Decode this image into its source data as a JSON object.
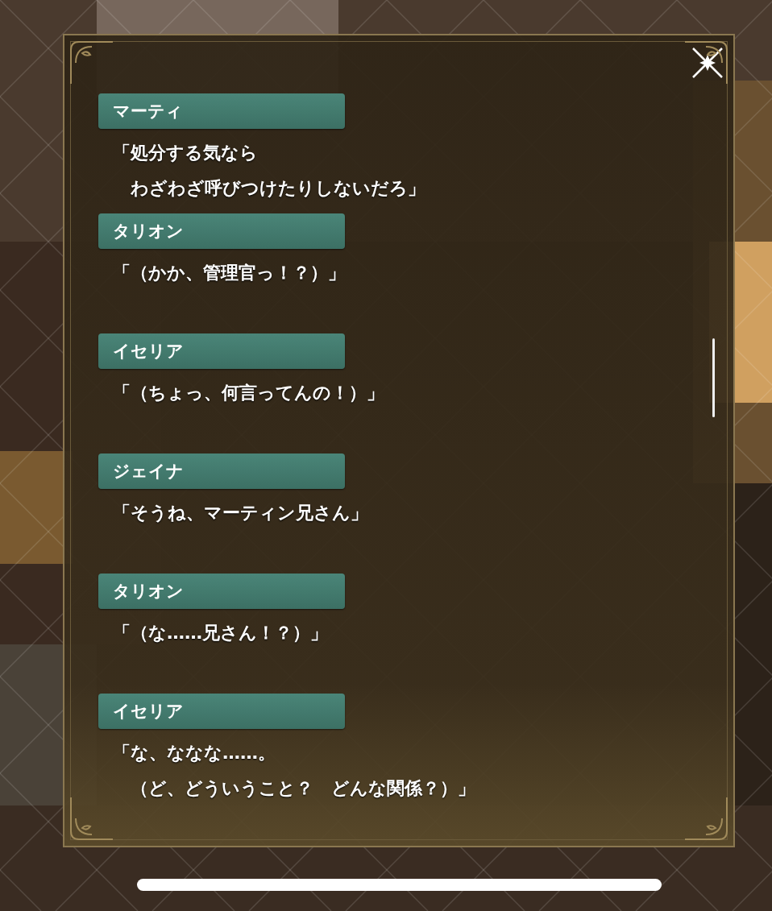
{
  "log_entries": [
    {
      "speaker": "マーティ",
      "lines": [
        "「処分する気なら",
        "わざわざ呼びつけたりしないだろ」"
      ]
    },
    {
      "speaker": "タリオン",
      "lines": [
        "「（かか、管理官っ！？）」"
      ]
    },
    {
      "speaker": "イセリア",
      "lines": [
        "「（ちょっ、何言ってんの！）」"
      ]
    },
    {
      "speaker": "ジェイナ",
      "lines": [
        "「そうね、マーティン兄さん」"
      ]
    },
    {
      "speaker": "タリオン",
      "lines": [
        "「（な……兄さん！？）」"
      ]
    },
    {
      "speaker": "イセリア",
      "lines": [
        "「な、ななな……。",
        "（ど、どういうこと？　どんな関係？）」"
      ]
    }
  ]
}
